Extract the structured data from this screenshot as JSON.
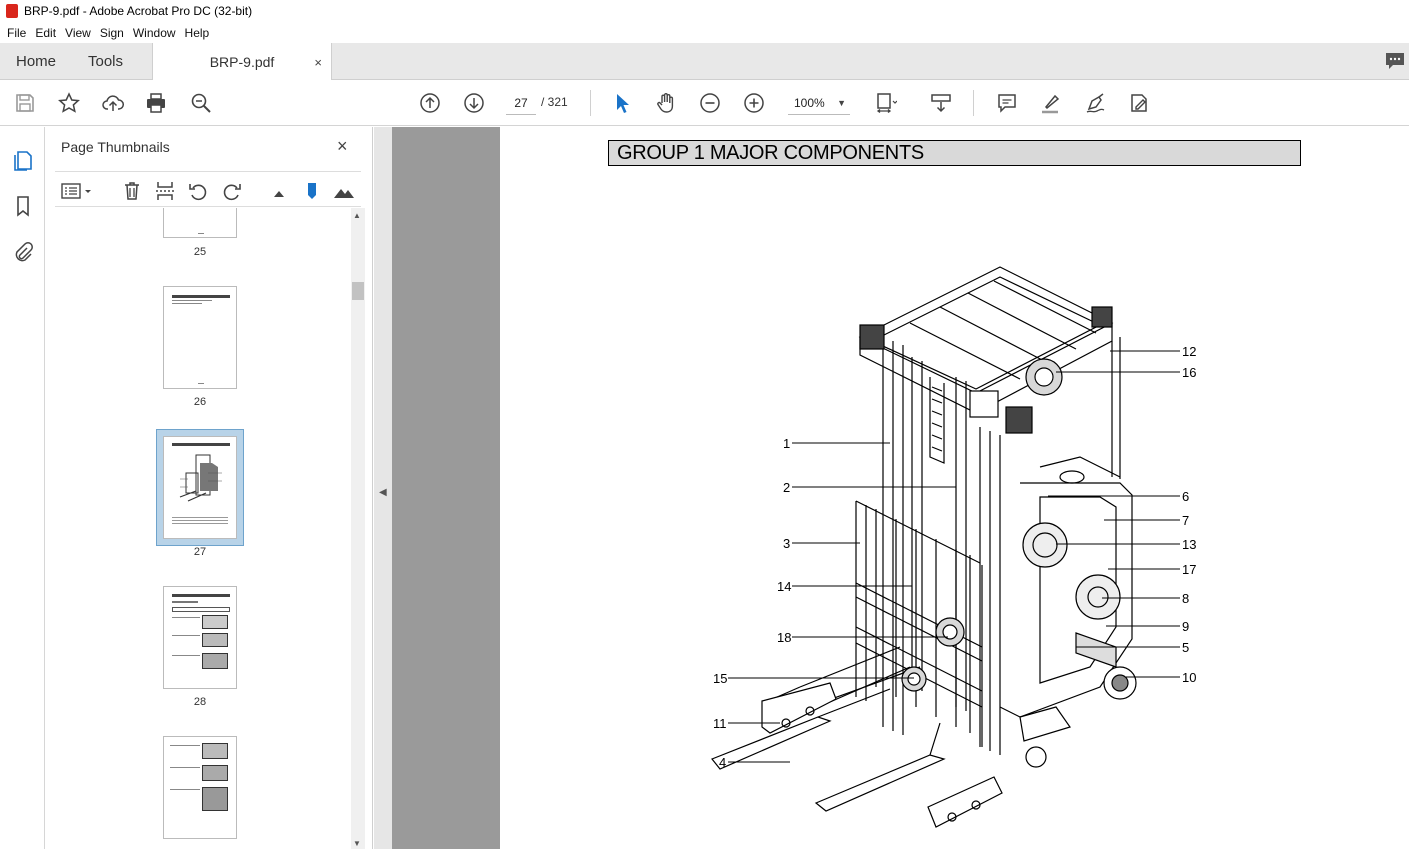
{
  "window": {
    "title": "BRP-9.pdf - Adobe Acrobat Pro DC (32-bit)"
  },
  "menu": [
    "File",
    "Edit",
    "View",
    "Sign",
    "Window",
    "Help"
  ],
  "tabs": {
    "home": "Home",
    "tools": "Tools",
    "doc": "BRP-9.pdf",
    "close": "×"
  },
  "toolbar": {
    "page_current": "27",
    "page_total": "/ 321",
    "zoom": "100%"
  },
  "sidebar": {
    "title": "Page Thumbnails",
    "close": "×",
    "thumbnails": [
      {
        "label": "25"
      },
      {
        "label": "26"
      },
      {
        "label": "27",
        "selected": true
      },
      {
        "label": "28"
      },
      {
        "label": ""
      }
    ]
  },
  "document": {
    "heading": "GROUP  1  MAJOR COMPONENTS",
    "callouts": [
      "1",
      "2",
      "3",
      "14",
      "18",
      "15",
      "11",
      "4",
      "12",
      "16",
      "6",
      "7",
      "13",
      "17",
      "8",
      "9",
      "5",
      "10"
    ]
  },
  "colors": {
    "accent": "#1a73c8",
    "pdf_red": "#d9261c",
    "page_bg": "#9a9a9a"
  }
}
